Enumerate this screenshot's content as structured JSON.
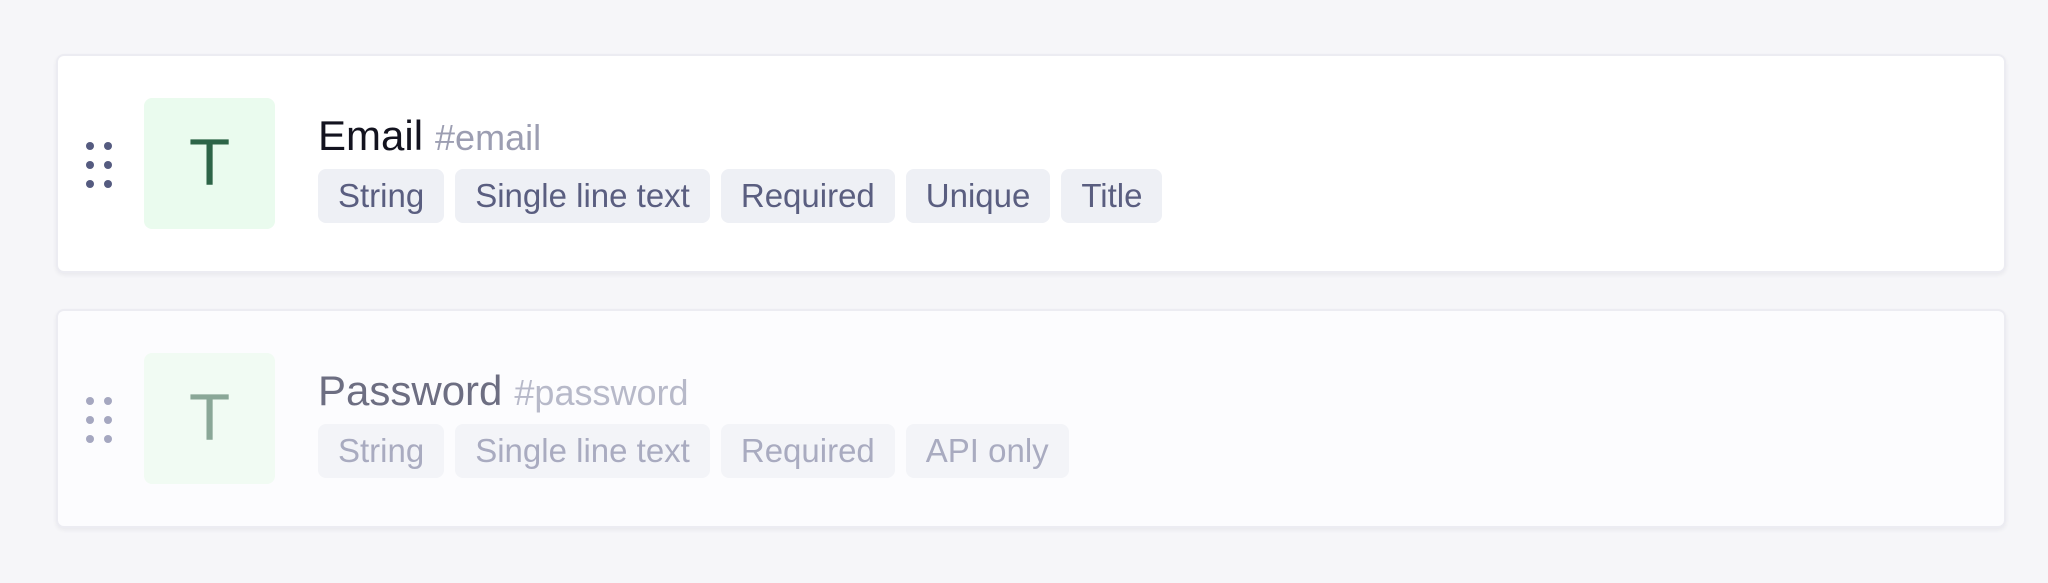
{
  "fields": [
    {
      "name": "Email",
      "key": "#email",
      "type_letter": "T",
      "tags": [
        "String",
        "Single line text",
        "Required",
        "Unique",
        "Title"
      ]
    },
    {
      "name": "Password",
      "key": "#password",
      "type_letter": "T",
      "tags": [
        "String",
        "Single line text",
        "Required",
        "API only"
      ]
    }
  ],
  "icons": {
    "drag_handle": "drag-handle-icon",
    "type": "text-type-icon"
  },
  "colors": {
    "tile_bg": "#eafbee",
    "tile_letter": "#2d6447",
    "tag_bg": "#eef0f5",
    "tag_text": "#5a5e80"
  }
}
